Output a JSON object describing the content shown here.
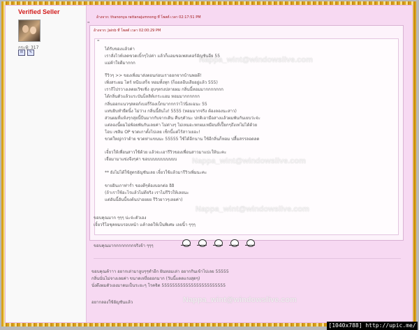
{
  "seller_label": "Verified Seller",
  "user_stats": "กระทู้: 317",
  "post_header": "อ้างจาก: thanonya rattanajumnong ที่ โพสต์ เวลา 02:17:51 PM",
  "quote_mark": "\"",
  "quote_header": "อ้างจาก: Jainb ที่ โพสต์ เวลา 02:00:29 PM",
  "quote_mark2": "\"",
  "quote_lines": [
    "ได้รับของแล้วค่า",
    "เราสั่งไวท์เลดขวดเบิ้กๆไปค่า แล้วก็แอมขอเพสเตอร์อัญชันอีย 55",
    "แม่ค้าใจดีมากกก",
    "รีวิวๆ >> ของเพิ่งมาส่งตอนก่อนเราออกจากบ้านพอดี!",
    "เพิ่งสระผม ไดร์ หนีบเสร็จ หอมทั้งทุก (ก็ออลอีบเสียอยู่แล้ว 555)",
    "เรากีไปรวางเลดยเวิชเชิ่ง ฮุบๆตรงปลายผม กลิ่นนี้หอมมากกกกกกก",
    "ได้กลิ่นตัวแล้วแระบันบ็ลลิท์เกระแอม หอมมากกกกกก",
    "กลิ่นออกแนวๆสตอก์เบอรี่ร้องเบ็กมากกกว่าไว่นิ่งแฉนะ 55",
    "แท่บยิบทำยืดนิ้ง ไม่ว่าง กลิ่นนี้ยันไง! 5555 (หอมมากจริง ต้องลองนะสาว)",
    "ส่วนผมที่แห้งๆกลุ่ยนี้บีนมากกับจากเดิน คืนๆตัวนะ ปกติเอามือสางแล้วผมพันกันเยบว่ะจ่ะ",
    "แต่ลองนี้ผมไม่พ้อยพันกันเลยค่า ไม่ต่างๆ ไม่เหมอะหกผมเหมือนที่เปีียกๆถึงเทไม่ได้ด้วย",
    "โอบ เชลิม OP ขวดเกาตั้งไปเลย เช็กนี้แต่ไร้สาวเยอะ!",
    "ขวดใหญ่กว่าด้าย ขวดห่าแขนนะ 55555 ใช้ได้อีกนาน ใช้อีกลิ่นก็หอม ปลื้มสรรลอดลด",
    "เจี๋ยวให้เพื่อนสาวใช้ด้วย แล้วจะเอารีวิวของเพื่อนสาวมาแปะให้นะคะ",
    "เจื่อมามาแข่งจีงๆค่า ขอบบบบบบบบบบบ",
    "** ยังไม่ได้ใช้สูตรอัญชันเลย เจี๋ยวใช้แล้วมารีวิวเพิ่มนะคะ",
    "ขายอินเกาท่าร่ำ ของดีๆต้องบอกต่อ อิอิ",
    "(ถ้าเราใช้อะไรแล้วไม่ดีจริง เราไม่รีวิวให้เลยนะ",
    "แต่อันนี้อันนี้จงต้นปาอยยย รีวิวยาวๆเลยค่า)"
  ],
  "reply1_lines": [
    "ขอบคุณมาก ๆๆๆ น่ะจ่ะตัวเอง",
    "เจี๋ยวรีโอชุคหมบรอบหน้า แค้าลดให้เป็นพิเศษ เลยนิ้า ๆๆๆ"
  ],
  "reply1_thanks": "ขอบคุณมากกกกกกกกจริงจ้า ๆๆๆ",
  "emote_icons": [
    "pig-emote-icon",
    "pig-emote-icon",
    "pig-emote-icon",
    "pig-emote-icon",
    "pig-emote-icon"
  ],
  "reply2_lines": [
    "ขอบคุณค้าาา อยากเล่ามาลูบๆๆทำอีก ฝันหอมเล่า อยากกินเข้าไปเลย 55555",
    "กลิ่นนั่นไม่จางเลยค่า ขนาดเหงื่อออกมาก (วันนี้แดดแรงสุดๆ)",
    "นั่งดึงผมตัวเองมาดมเป็นระยะๆ โรคจิต 555555555555555555555555"
  ],
  "reply3_line": "อยากลองใช้อัญชันแล้ว",
  "watermark_text": "Nappa_wint@windowslive.com",
  "credit_text": "[1040x788] http://upic.me/"
}
